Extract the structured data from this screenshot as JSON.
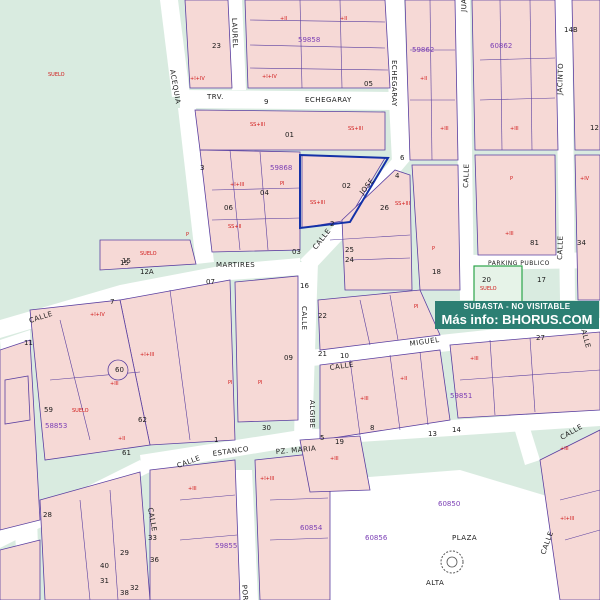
{
  "map": {
    "colors": {
      "background": "#d9ebe0",
      "building": "#f6d9d6",
      "street": "#ffffff",
      "parcel_line": "#5a3fa0",
      "highlight": "#1431a8",
      "label_red": "#d01818",
      "parcel_id": "#7b3fb5",
      "banner": "#2c7f73"
    },
    "streets": [
      {
        "text": "ECHEGARAY"
      },
      {
        "text": "TRV."
      },
      {
        "text": "ECHEGARAY"
      },
      {
        "text": "MARTIRES"
      },
      {
        "text": "CALLE"
      },
      {
        "text": "CALLE"
      },
      {
        "text": "JOSE"
      },
      {
        "text": "CALLE"
      },
      {
        "text": "MIGUEL"
      },
      {
        "text": "CALLE"
      },
      {
        "text": "ALGIBE"
      },
      {
        "text": "CALLE"
      },
      {
        "text": "ESTANCO"
      },
      {
        "text": "PZ. MARIA"
      },
      {
        "text": "CALLE"
      },
      {
        "text": "PLAZA"
      },
      {
        "text": "ALTA"
      },
      {
        "text": "ACEQUIA"
      },
      {
        "text": "LAUREL"
      },
      {
        "text": "JUAN"
      },
      {
        "text": "JACINTO"
      },
      {
        "text": "CALLE"
      },
      {
        "text": "CALLE"
      },
      {
        "text": "PARKING PUBLICO"
      },
      {
        "text": "CALLE"
      },
      {
        "text": "CALLE"
      },
      {
        "text": "CALLE"
      },
      {
        "text": "PORNO"
      }
    ],
    "parcel_ids": [
      "59858",
      "59862",
      "60862",
      "59868",
      "59851",
      "58853",
      "59855",
      "60854",
      "60856",
      "60850"
    ],
    "numbers": [
      "23",
      "05",
      "01",
      "02",
      "04",
      "06",
      "34",
      "18",
      "20",
      "17",
      "62",
      "59",
      "61",
      "60",
      "09",
      "22",
      "21",
      "19",
      "13",
      "14",
      "28",
      "26",
      "29",
      "31",
      "15",
      "12A",
      "03",
      "07",
      "08",
      "11",
      "10",
      "16",
      "25",
      "24",
      "27",
      "30",
      "32",
      "33",
      "36",
      "38",
      "40",
      "81",
      "9",
      "3",
      "5",
      "1",
      "2",
      "4",
      "6",
      "7",
      "8",
      "12",
      "14B",
      "15"
    ],
    "red_labels": [
      "SUELO",
      "+I+IV",
      "SS+III",
      "+II",
      "+III",
      "+IV",
      "P",
      "PI",
      "+I+III",
      "SS+II"
    ]
  },
  "banner": {
    "line1": "SUBASTA - NO VISITABLE",
    "line2": "Más info: BHORUS.COM"
  }
}
